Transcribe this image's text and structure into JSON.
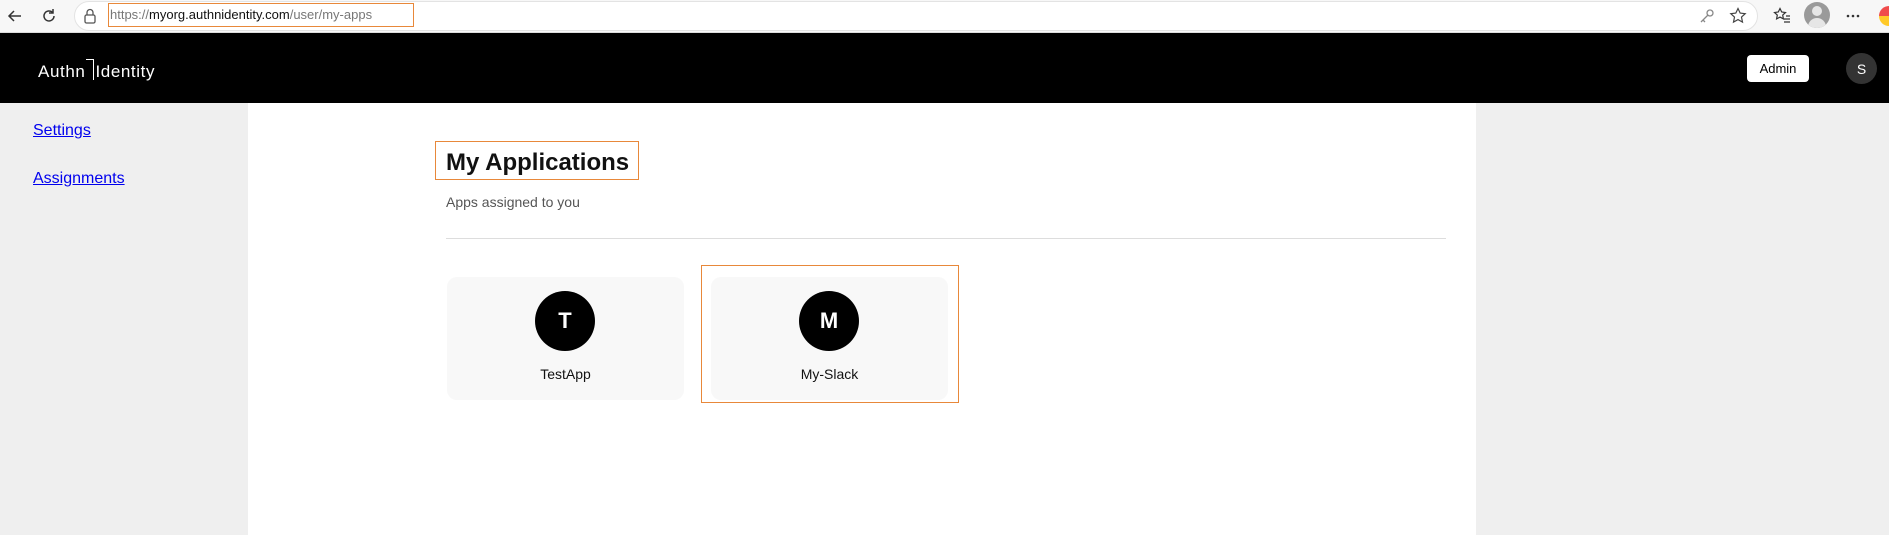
{
  "browser": {
    "url_scheme": "https://",
    "url_domain": "myorg.authnidentity.com",
    "url_path": "/user/my-apps"
  },
  "header": {
    "logo_left": "Authn",
    "logo_right": "Identity",
    "admin_label": "Admin",
    "user_initial": "S"
  },
  "sidebar": {
    "items": [
      {
        "label": "Settings"
      },
      {
        "label": "Assignments"
      }
    ]
  },
  "main": {
    "title": "My Applications",
    "subtitle": "Apps assigned to you",
    "apps": [
      {
        "initial": "T",
        "name": "TestApp"
      },
      {
        "initial": "M",
        "name": "My-Slack"
      }
    ]
  },
  "colors": {
    "header_bg": "#000000",
    "link": "#0000ee",
    "highlight": "#e8883a"
  }
}
